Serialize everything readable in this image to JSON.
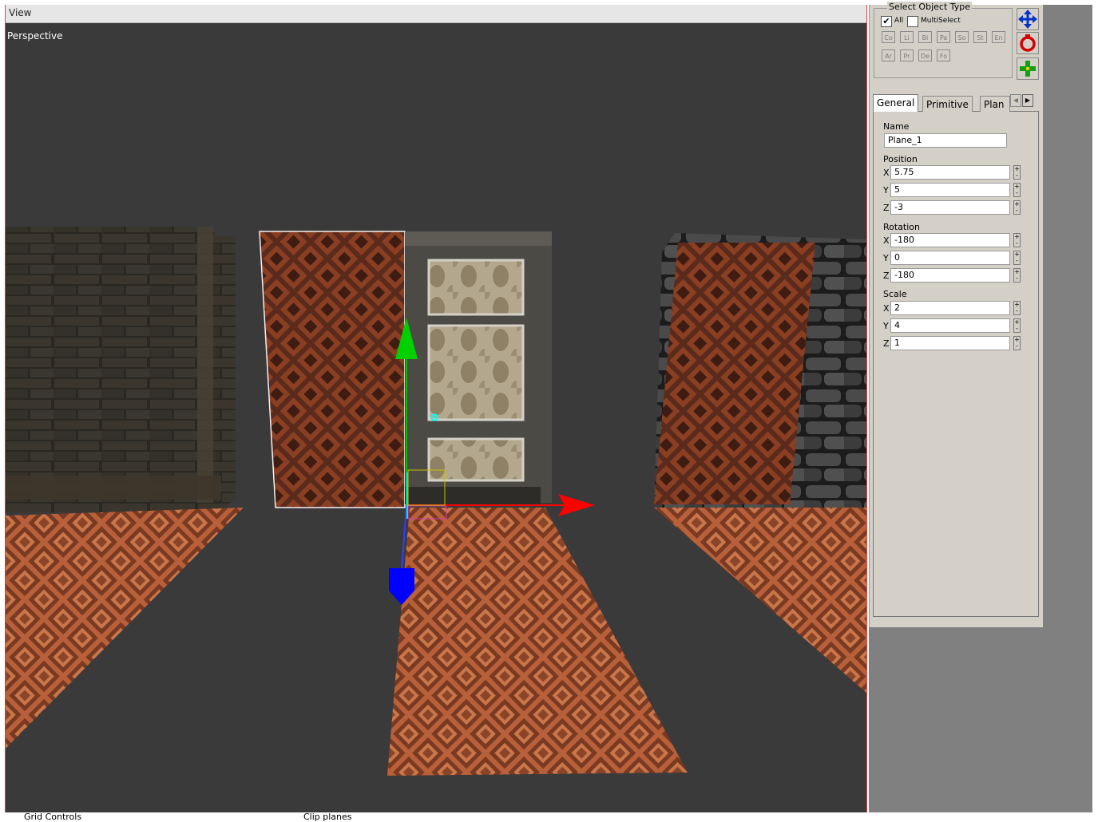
{
  "viewport": {
    "menu": "View",
    "camera_label": "Perspective"
  },
  "select_type": {
    "title": "Select Object Type",
    "all_label": "All",
    "all_checked": true,
    "multiselect_label": "MultiSelect",
    "multiselect_checked": false,
    "row1": [
      "Co",
      "Li",
      "Bi",
      "Pa",
      "So",
      "St",
      "En"
    ],
    "row2": [
      "Ar",
      "Pr",
      "De",
      "Fo"
    ]
  },
  "tools": {
    "move_icon": "move-arrows-icon",
    "rotate_icon": "rotate-circle-icon",
    "scale_icon": "scale-plus-icon",
    "move_color": "#0033cc",
    "rotate_color": "#d40000",
    "scale_color": "#10a010"
  },
  "tabs": [
    "General",
    "Primitive",
    "Plan"
  ],
  "general": {
    "name_label": "Name",
    "name_value": "Plane_1",
    "position_label": "Position",
    "position": {
      "x": "5.75",
      "y": "5",
      "z": "-3"
    },
    "rotation_label": "Rotation",
    "rotation": {
      "x": "-180",
      "y": "0",
      "z": "-180"
    },
    "scale_label": "Scale",
    "scale": {
      "x": "2",
      "y": "4",
      "z": "1"
    },
    "axis_x": "X",
    "axis_y": "Y",
    "axis_z": "Z"
  },
  "bottom": {
    "grid_controls": "Grid Controls",
    "clip_planes": "Clip planes"
  },
  "gizmo_colors": {
    "x": "#ff0000",
    "y": "#00c000",
    "z": "#0000ff"
  }
}
